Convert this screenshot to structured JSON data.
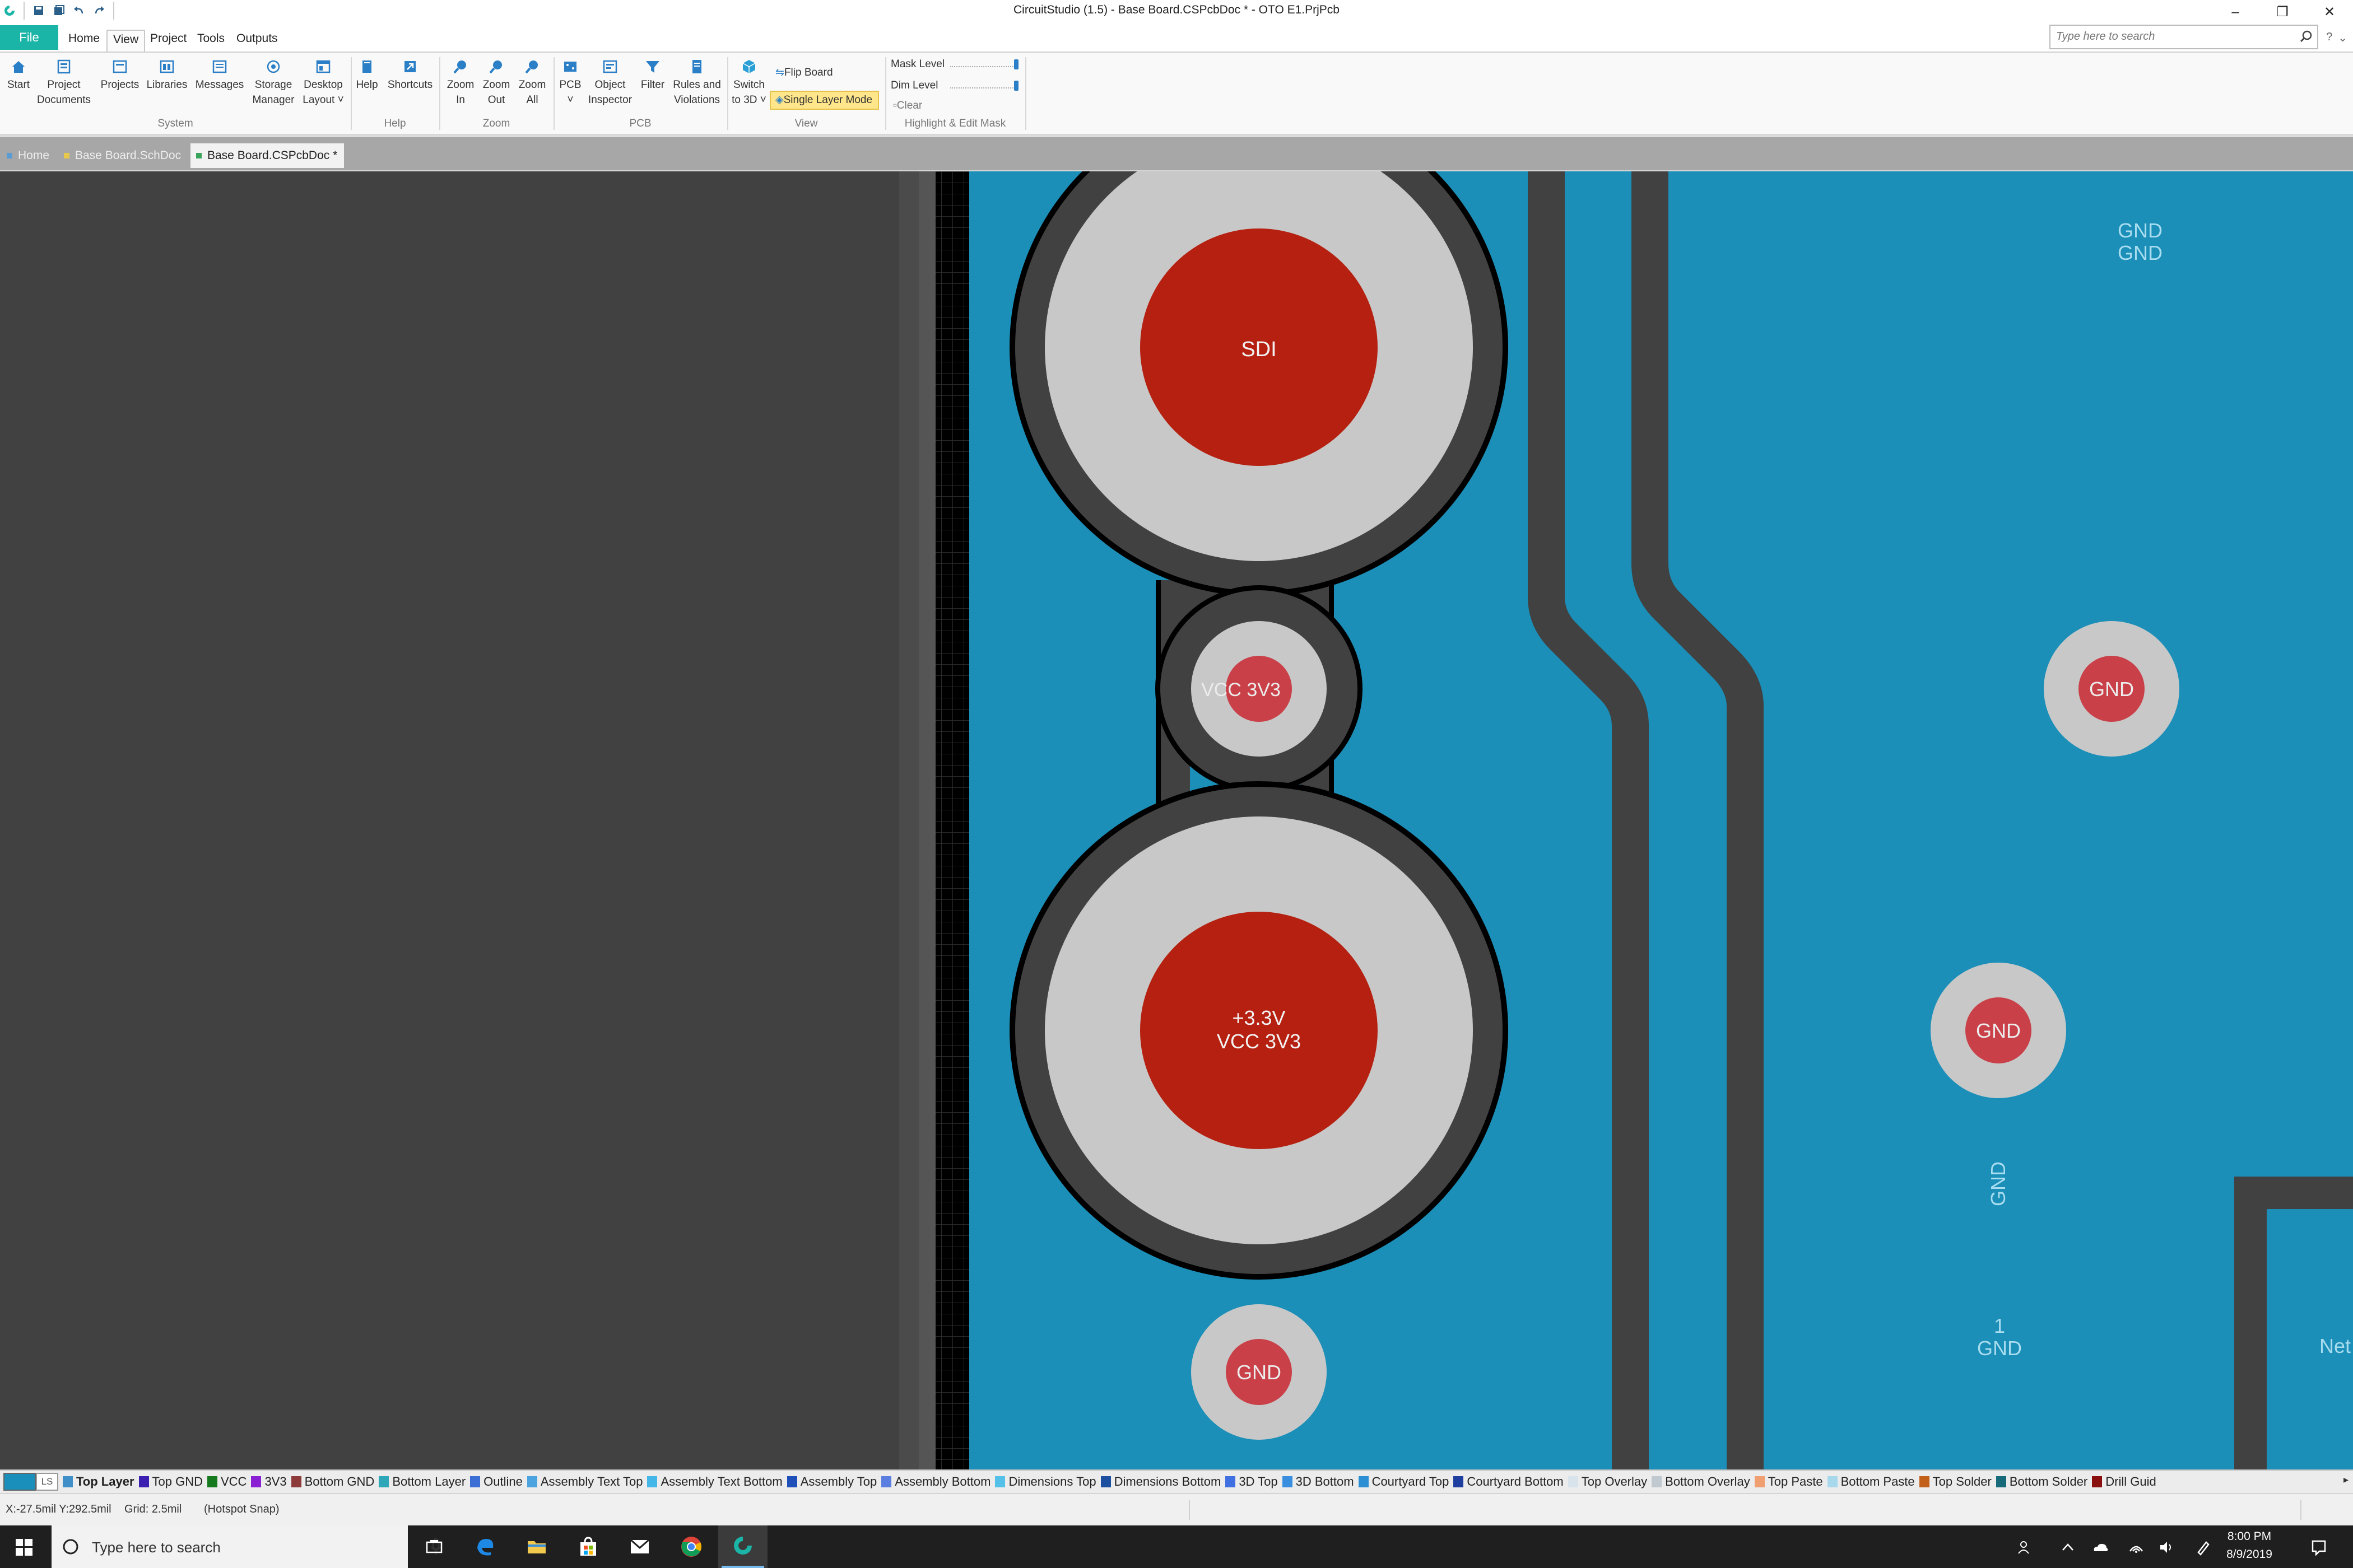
{
  "window": {
    "title": "CircuitStudio (1.5) - Base Board.CSPcbDoc * - OTO E1.PrjPcb",
    "search_placeholder": "Type here to search",
    "controls": [
      "minimize",
      "restore",
      "close"
    ]
  },
  "ribbon_tabs": [
    "File",
    "Home",
    "View",
    "Project",
    "Tools",
    "Outputs"
  ],
  "active_ribbon_tab": "View",
  "ribbon": {
    "system": {
      "label": "System",
      "buttons": [
        {
          "line1": "Start",
          "line2": "",
          "icon": "home-icon"
        },
        {
          "line1": "Project",
          "line2": "Documents",
          "icon": "project-documents-icon"
        },
        {
          "line1": "Projects",
          "line2": "",
          "icon": "projects-icon"
        },
        {
          "line1": "Libraries",
          "line2": "",
          "icon": "libraries-icon"
        },
        {
          "line1": "Messages",
          "line2": "",
          "icon": "messages-icon"
        },
        {
          "line1": "Storage",
          "line2": "Manager",
          "icon": "storage-manager-icon"
        },
        {
          "line1": "Desktop",
          "line2": "Layout ˅",
          "icon": "desktop-layout-icon"
        }
      ]
    },
    "help": {
      "label": "Help",
      "buttons": [
        {
          "line1": "Help",
          "line2": "",
          "icon": "help-book-icon"
        },
        {
          "line1": "Shortcuts",
          "line2": "",
          "icon": "shortcuts-icon"
        }
      ]
    },
    "zoom": {
      "label": "Zoom",
      "buttons": [
        {
          "line1": "Zoom",
          "line2": "In",
          "icon": "zoom-in-icon"
        },
        {
          "line1": "Zoom",
          "line2": "Out",
          "icon": "zoom-out-icon"
        },
        {
          "line1": "Zoom",
          "line2": "All",
          "icon": "zoom-all-icon"
        }
      ]
    },
    "pcb": {
      "label": "PCB",
      "buttons": [
        {
          "line1": "PCB",
          "line2": "˅",
          "icon": "pcb-icon"
        },
        {
          "line1": "Object",
          "line2": "Inspector",
          "icon": "object-inspector-icon"
        },
        {
          "line1": "Filter",
          "line2": "",
          "icon": "filter-icon"
        },
        {
          "line1": "Rules and",
          "line2": "Violations",
          "icon": "rules-violations-icon"
        }
      ]
    },
    "view": {
      "label": "View",
      "switch_3d": {
        "line1": "Switch",
        "line2": "to 3D ˅",
        "icon": "cube-3d-icon"
      },
      "flip_board": "Flip Board",
      "single_layer_mode": "Single Layer Mode"
    },
    "highlight": {
      "label": "Highlight & Edit Mask",
      "mask_level": "Mask Level",
      "dim_level": "Dim Level",
      "clear": "Clear",
      "mask_level_value": 1.0,
      "dim_level_value": 1.0
    }
  },
  "document_tabs": [
    {
      "label": "Home",
      "color": "#5a9bd4",
      "active": false
    },
    {
      "label": "Base Board.SchDoc",
      "color": "#e8c84a",
      "active": false
    },
    {
      "label": "Base Board.CSPcbDoc *",
      "color": "#3aa35c",
      "active": true
    }
  ],
  "pcb_canvas": {
    "background_color": "#414141",
    "board_color": "#1b8fb8",
    "pad_color": "#c8c8c8",
    "pad_center_color": "#b52010",
    "small_pad_center_color": "#c94048",
    "labels": {
      "big_pad_top": "SDI",
      "via_small": "VCC 3V3",
      "big_pad_bottom_line1": "+3.3V",
      "big_pad_bottom_line2": "VCC 3V3",
      "via_bottom": "GND",
      "pad_right_1": "GND",
      "pad_right_2": "GND",
      "gnd_top_line1": "GND",
      "gnd_top_line2": "GND",
      "gnd_vertical": "GND",
      "pin1_line1": "1",
      "pin1_line2": "GND",
      "net_cut": "Net"
    }
  },
  "layers": [
    {
      "name": "Top Layer",
      "color": "#3f8fc9",
      "active": true
    },
    {
      "name": "Top GND",
      "color": "#3a1fb0"
    },
    {
      "name": "VCC",
      "color": "#157a1e"
    },
    {
      "name": "3V3",
      "color": "#8a20d4"
    },
    {
      "name": "Bottom GND",
      "color": "#8c3a3a"
    },
    {
      "name": "Bottom Layer",
      "color": "#2ea8b8"
    },
    {
      "name": "Outline",
      "color": "#3b6fd6"
    },
    {
      "name": "Assembly Text Top",
      "color": "#4ba3e0"
    },
    {
      "name": "Assembly Text Bottom",
      "color": "#45b6e8"
    },
    {
      "name": "Assembly Top",
      "color": "#1f4fb8"
    },
    {
      "name": "Assembly Bottom",
      "color": "#5a7fe0"
    },
    {
      "name": "Dimensions Top",
      "color": "#55c1e8"
    },
    {
      "name": "Dimensions Bottom",
      "color": "#1d4fa0"
    },
    {
      "name": "3D Top",
      "color": "#3f6fe0"
    },
    {
      "name": "3D Bottom",
      "color": "#3a8ee0"
    },
    {
      "name": "Courtyard Top",
      "color": "#2c8fd4"
    },
    {
      "name": "Courtyard Bottom",
      "color": "#1f3fa0"
    },
    {
      "name": "Top Overlay",
      "color": "#d8e3ec"
    },
    {
      "name": "Bottom Overlay",
      "color": "#c0c8d0"
    },
    {
      "name": "Top Paste",
      "color": "#f0a070"
    },
    {
      "name": "Bottom Paste",
      "color": "#a8d8ec"
    },
    {
      "name": "Top Solder",
      "color": "#c2601a"
    },
    {
      "name": "Bottom Solder",
      "color": "#166a7a"
    },
    {
      "name": "Drill Guid",
      "color": "#8a1010"
    }
  ],
  "layer_ls_label": "LS",
  "status": {
    "coords": "X:-27.5mil Y:292.5mil",
    "grid": "Grid: 2.5mil",
    "snap": "(Hotspot Snap)"
  },
  "taskbar": {
    "search_placeholder": "Type here to search",
    "time": "8:00 PM",
    "date": "8/9/2019",
    "pinned": [
      "task-view-icon",
      "edge-icon",
      "file-explorer-icon",
      "store-icon",
      "mail-icon",
      "chrome-icon",
      "circuitstudio-icon"
    ]
  }
}
